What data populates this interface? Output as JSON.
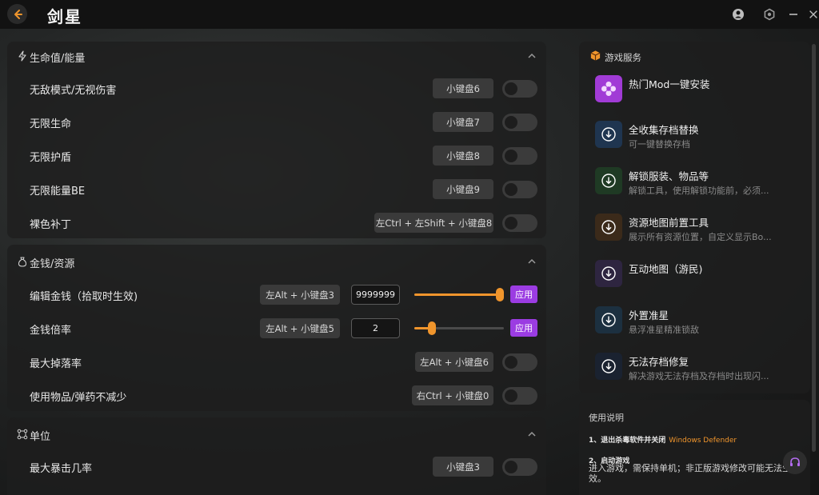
{
  "app": {
    "title": "剑星"
  },
  "sections": [
    {
      "title": "生命值/能量",
      "icon": "lightning-icon",
      "rows": [
        {
          "label": "无敌模式/无视伤害",
          "hotkey": "小键盘6"
        },
        {
          "label": "无限生命",
          "hotkey": "小键盘7"
        },
        {
          "label": "无限护盾",
          "hotkey": "小键盘8"
        },
        {
          "label": "无限能量BE",
          "hotkey": "小键盘9"
        },
        {
          "label": "裸色补丁",
          "hotkey": "左Ctrl + 左Shift + 小键盘8"
        }
      ]
    },
    {
      "title": "金钱/资源",
      "icon": "money-bag-icon",
      "rows": [
        {
          "label": "编辑金钱（拾取时生效)",
          "hotkey": "左Alt + 小键盘3",
          "input": "9999999",
          "slider_fraction": 0.98,
          "apply": "应用"
        },
        {
          "label": "金钱倍率",
          "hotkey": "左Alt + 小键盘5",
          "input": "2",
          "slider_fraction": 0.2,
          "apply": "应用"
        },
        {
          "label": "最大掉落率",
          "hotkey": "左Alt + 小键盘6"
        },
        {
          "label": "使用物品/弹药不减少",
          "hotkey": "右Ctrl + 小键盘0"
        }
      ]
    },
    {
      "title": "单位",
      "icon": "nodes-icon",
      "rows": [
        {
          "label": "最大暴击几率",
          "hotkey": "小键盘3"
        }
      ]
    }
  ],
  "services": {
    "title": "游戏服务",
    "items": [
      {
        "name": "热门Mod一键安装",
        "desc": "",
        "icon": "mod-flower-icon",
        "color": "#a13bd6"
      },
      {
        "name": "全收集存档替换",
        "desc": "可一键替换存档",
        "icon": "download-circle-icon",
        "color": "#2a3b4f"
      },
      {
        "name": "解锁服装、物品等",
        "desc": "解锁工具，使用解锁功能前，必须...",
        "icon": "download-circle-icon",
        "color": "#1f3a24"
      },
      {
        "name": "资源地图前置工具",
        "desc": "展示所有资源位置，自定义显示Bo...",
        "icon": "download-circle-icon",
        "color": "#3b2a1a"
      },
      {
        "name": "互动地图（游民)",
        "desc": "",
        "icon": "download-circle-icon",
        "color": "#2e2540"
      },
      {
        "name": "外置准星",
        "desc": "悬浮准星精准锁敌",
        "icon": "download-circle-icon",
        "color": "#1c3040"
      },
      {
        "name": "无法存档修复",
        "desc": "解决游戏无法存档及存档时出现闪...",
        "icon": "download-circle-icon",
        "color": "#1a2230"
      }
    ]
  },
  "help": {
    "title": "使用说明",
    "step1": "1、退出杀毒软件并关闭",
    "step1_link": "Windows Defender",
    "step2": "2、启动游戏",
    "step2_text": "进入游戏，需保持单机；非正版游戏修改可能无法生效。"
  },
  "colors": {
    "accent": "#f0952c",
    "apply": "#9b3ce2"
  }
}
